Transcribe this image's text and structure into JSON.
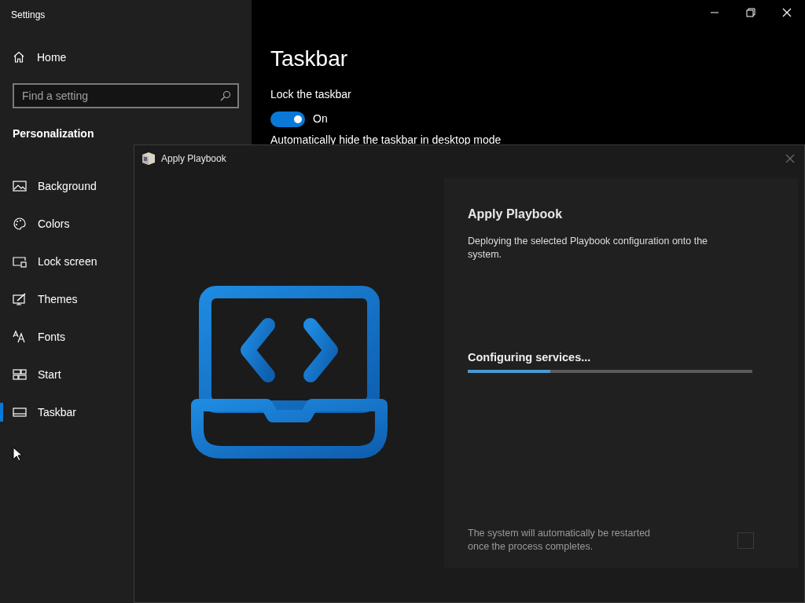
{
  "window": {
    "title": "Settings"
  },
  "sidebar": {
    "home": "Home",
    "search": {
      "placeholder": "Find a setting"
    },
    "section": "Personalization",
    "items": [
      {
        "label": "Background",
        "selected": false
      },
      {
        "label": "Colors",
        "selected": false
      },
      {
        "label": "Lock screen",
        "selected": false
      },
      {
        "label": "Themes",
        "selected": false
      },
      {
        "label": "Fonts",
        "selected": false
      },
      {
        "label": "Start",
        "selected": false
      },
      {
        "label": "Taskbar",
        "selected": true
      }
    ]
  },
  "page": {
    "title": "Taskbar",
    "settings": [
      {
        "label": "Lock the taskbar",
        "on": true,
        "state": "On"
      }
    ],
    "next_label": "Automatically hide the taskbar in desktop mode"
  },
  "dialog": {
    "title": "Apply Playbook",
    "heading": "Apply Playbook",
    "description": "Deploying the selected Playbook configuration onto the system.",
    "status": "Configuring services...",
    "progress": {
      "level": 0.29
    },
    "note": "The system will automatically be restarted once the process completes.",
    "checkbox": {
      "checked": false
    }
  }
}
